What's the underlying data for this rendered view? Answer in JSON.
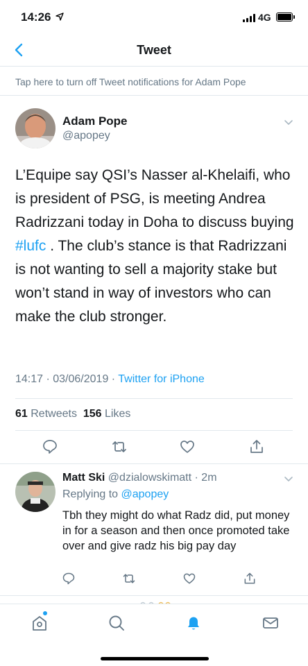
{
  "status": {
    "time": "14:26",
    "network": "4G"
  },
  "nav": {
    "title": "Tweet",
    "back_icon": "chevron-left-icon"
  },
  "banner": {
    "text": "Tap here to turn off Tweet notifications for Adam Pope"
  },
  "tweet": {
    "author_name": "Adam Pope",
    "author_handle": "@apopey",
    "text_before": "L’Equipe say QSI’s Nasser al-Khelaifi, who is president of PSG, is meeting Andrea Radrizzani today in Doha to discuss buying ",
    "hashtag": "#lufc",
    "text_after": " . The club’s stance is that Radrizzani is not wanting to sell a majority stake but won’t stand in way of investors who can make the club stronger.",
    "timestamp": "14:17 · 03/06/2019 · ",
    "source": "Twitter for iPhone",
    "retweets_count": "61",
    "retweets_label": "Retweets",
    "likes_count": "156",
    "likes_label": "Likes"
  },
  "reply": {
    "author_name": "Matt Ski",
    "author_handle": "@dzialowskimatt · 2m",
    "replying_label": "Replying to ",
    "replying_to": "@apopey",
    "text": "Tbh they might do what Radz did, put money in for a season and then once promoted take over and give radz his big pay day"
  },
  "colors": {
    "accent": "#1da1f2",
    "secondary_text": "#657786",
    "divider": "#e1e8ed"
  },
  "tab_bar": {
    "icons": [
      "home-icon",
      "search-icon",
      "notifications-icon",
      "messages-icon"
    ],
    "active": "notifications-icon"
  }
}
